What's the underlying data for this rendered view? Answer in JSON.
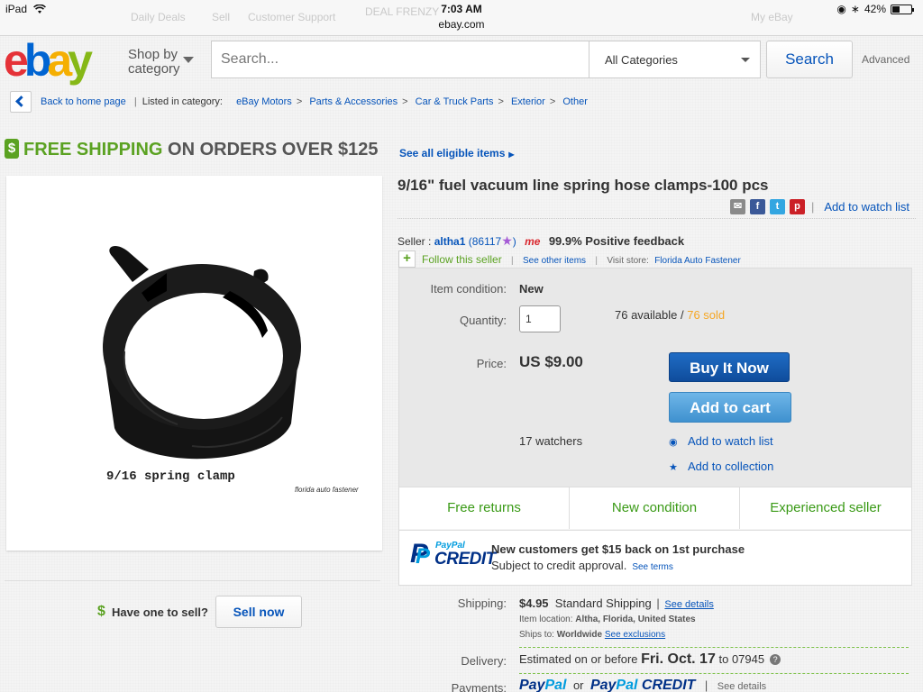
{
  "status_bar": {
    "device": "iPad",
    "time": "7:03 AM",
    "url": "ebay.com",
    "battery": "42%",
    "battery_level": 0.42,
    "background_tabs": [
      "Daily Deals",
      "Sell",
      "Customer Support",
      "DEAL FRENZY",
      "My eBay"
    ]
  },
  "header": {
    "logo_letters": [
      "e",
      "b",
      "a",
      "y"
    ],
    "shop_by_line1": "Shop by",
    "shop_by_line2": "category",
    "search_placeholder": "Search...",
    "category_selected": "All Categories",
    "search_button": "Search",
    "advanced_link": "Advanced"
  },
  "breadcrumb": {
    "back_label": "Back to home page",
    "listed_in": "Listed in category:",
    "items": [
      "eBay Motors",
      "Parts & Accessories",
      "Car & Truck Parts",
      "Exterior",
      "Other"
    ]
  },
  "banner": {
    "icon_glyph": "$",
    "green_text": "FREE SHIPPING",
    "dark_text": "ON ORDERS OVER $125",
    "link": "See all eligible items"
  },
  "image": {
    "caption": "9/16 spring clamp",
    "credit": "florida auto fastener"
  },
  "sell": {
    "label": "Have one to sell?",
    "button": "Sell now"
  },
  "item": {
    "title": "9/16\" fuel vacuum line spring hose clamps-100 pcs",
    "watch_list_link": "Add to watch list",
    "share_icons": [
      "email-icon",
      "facebook-icon",
      "twitter-icon",
      "pinterest-icon"
    ]
  },
  "seller": {
    "label": "Seller :",
    "name": "altha1",
    "score_open": "(86117",
    "score_close": ")",
    "me_badge": "me",
    "feedback": "99.9% Positive feedback",
    "follow": "Follow this seller",
    "other_items": "See other items",
    "visit_store_label": "Visit store:",
    "store": "Florida Auto Fastener"
  },
  "buy_box": {
    "condition_label": "Item condition:",
    "condition_value": "New",
    "quantity_label": "Quantity:",
    "quantity_value": "1",
    "available": "76 available",
    "available_sep": " / ",
    "sold": "76 sold",
    "price_label": "Price:",
    "price_value": "US $9.00",
    "buy_now": "Buy It Now",
    "add_to_cart": "Add to cart",
    "watchers": "17 watchers",
    "watch_link": "Add to watch list",
    "collection_link": "Add to collection",
    "badges": [
      "Free returns",
      "New condition",
      "Experienced seller"
    ]
  },
  "credit": {
    "logo_top": "PayPal",
    "logo_bottom": "CREDIT",
    "headline": "New customers get $15 back on 1st purchase",
    "subtext": "Subject to credit approval.",
    "terms_link": "See terms"
  },
  "shipping": {
    "label": "Shipping:",
    "cost": "$4.95",
    "method": "Standard Shipping",
    "details_link": "See details",
    "location_label": "Item location:",
    "location": "Altha, Florida, United States",
    "ships_to_label": "Ships to:",
    "ships_to": "Worldwide",
    "exclusions_link": "See exclusions"
  },
  "delivery": {
    "label": "Delivery:",
    "prefix": "Estimated on or before",
    "date": "Fri. Oct. 17",
    "suffix": "to 07945",
    "help_glyph": "?"
  },
  "payments": {
    "label": "Payments:",
    "paypal_a": "Pay",
    "paypal_b": "Pal",
    "or": "or",
    "credit_a": "Pay",
    "credit_b": "Pal",
    "credit_c": "CREDIT",
    "details_link": "See details"
  },
  "colors": {
    "ebay_red": "#e53238",
    "ebay_blue": "#0064d2",
    "ebay_yellow": "#f5af02",
    "ebay_green": "#86b817",
    "link_blue": "#0654ba",
    "shipping_green": "#5ba222",
    "sold_orange": "#f5a623",
    "buy_now_blue": "#1a5fb4",
    "add_cart_blue": "#4a9ad6"
  }
}
